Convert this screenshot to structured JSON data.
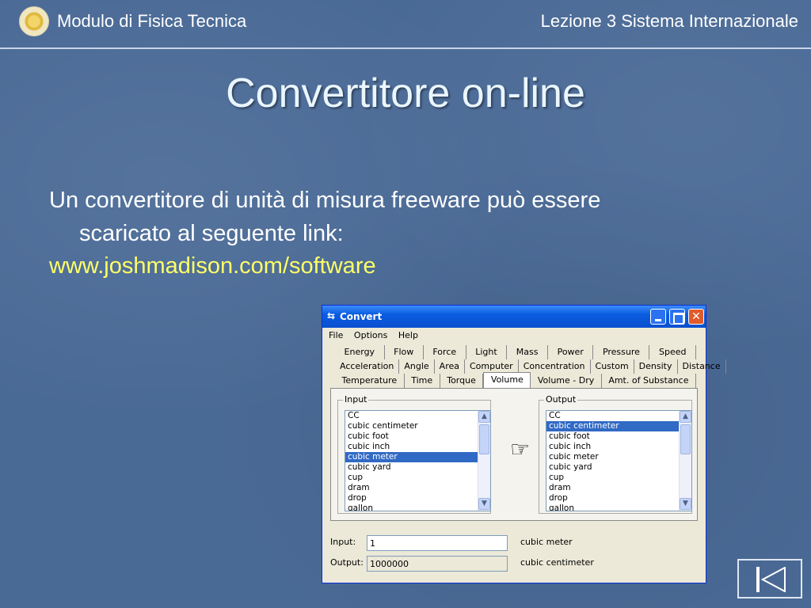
{
  "header": {
    "left": "Modulo di Fisica Tecnica",
    "right": "Lezione 3 Sistema Internazionale"
  },
  "slide": {
    "title": "Convertitore on-line",
    "paragraph_line1": "Un convertitore di unità di misura freeware può essere",
    "paragraph_line2": "scaricato al seguente link:",
    "link": "www.joshmadison.com/software"
  },
  "window": {
    "title": "Convert",
    "menu": [
      "File",
      "Options",
      "Help"
    ],
    "tab_rows": [
      [
        "Energy",
        "Flow",
        "Force",
        "Light",
        "Mass",
        "Power",
        "Pressure",
        "Speed"
      ],
      [
        "Acceleration",
        "Angle",
        "Area",
        "Computer",
        "Concentration",
        "Custom",
        "Density",
        "Distance"
      ],
      [
        "Temperature",
        "Time",
        "Torque",
        "Volume",
        "Volume - Dry",
        "Amt. of Substance"
      ]
    ],
    "active_tab": "Volume",
    "input_group_label": "Input",
    "output_group_label": "Output",
    "units": [
      "CC",
      "cubic centimeter",
      "cubic foot",
      "cubic inch",
      "cubic meter",
      "cubic yard",
      "cup",
      "dram",
      "drop",
      "gallon"
    ],
    "input_selected": "cubic meter",
    "output_selected": "cubic centimeter",
    "input_label": "Input:",
    "input_value": "1",
    "input_unit": "cubic meter",
    "output_label": "Output:",
    "output_value": "1000000",
    "output_unit": "cubic centimeter"
  },
  "icons": {
    "window_icon": "convert-arrows-icon",
    "hand": "pointing-hand-icon",
    "nav": "last-slide-icon"
  },
  "colors": {
    "background": "#4a6a96",
    "link": "#ffff66",
    "titlebar": "#0a5ce0",
    "selection": "#316ac5"
  }
}
